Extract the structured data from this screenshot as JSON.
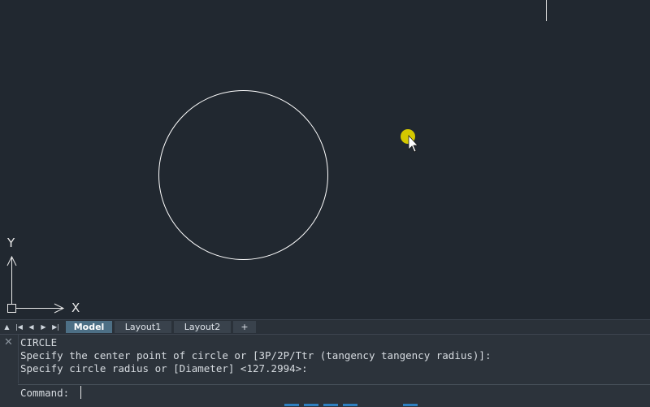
{
  "canvas": {
    "x_axis_label": "X",
    "y_axis_label": "Y",
    "colors": {
      "background": "#212830",
      "entity": "#ffffff",
      "cursor_highlight": "#d4c800"
    }
  },
  "tabs": {
    "nav_icons": [
      "first-layout-icon",
      "prev-layout-icon",
      "next-layout-icon",
      "last-layout-icon"
    ],
    "items": [
      {
        "label": "Model",
        "active": true
      },
      {
        "label": "Layout1",
        "active": false
      },
      {
        "label": "Layout2",
        "active": false
      },
      {
        "label": "+",
        "active": false
      }
    ]
  },
  "command": {
    "history": [
      "CIRCLE",
      "Specify the center point of circle or [3P/2P/Ttr (tangency tangency radius)]:",
      "Specify circle radius or [Diameter] <127.2994>:"
    ],
    "prompt": "Command:",
    "input_value": ""
  }
}
